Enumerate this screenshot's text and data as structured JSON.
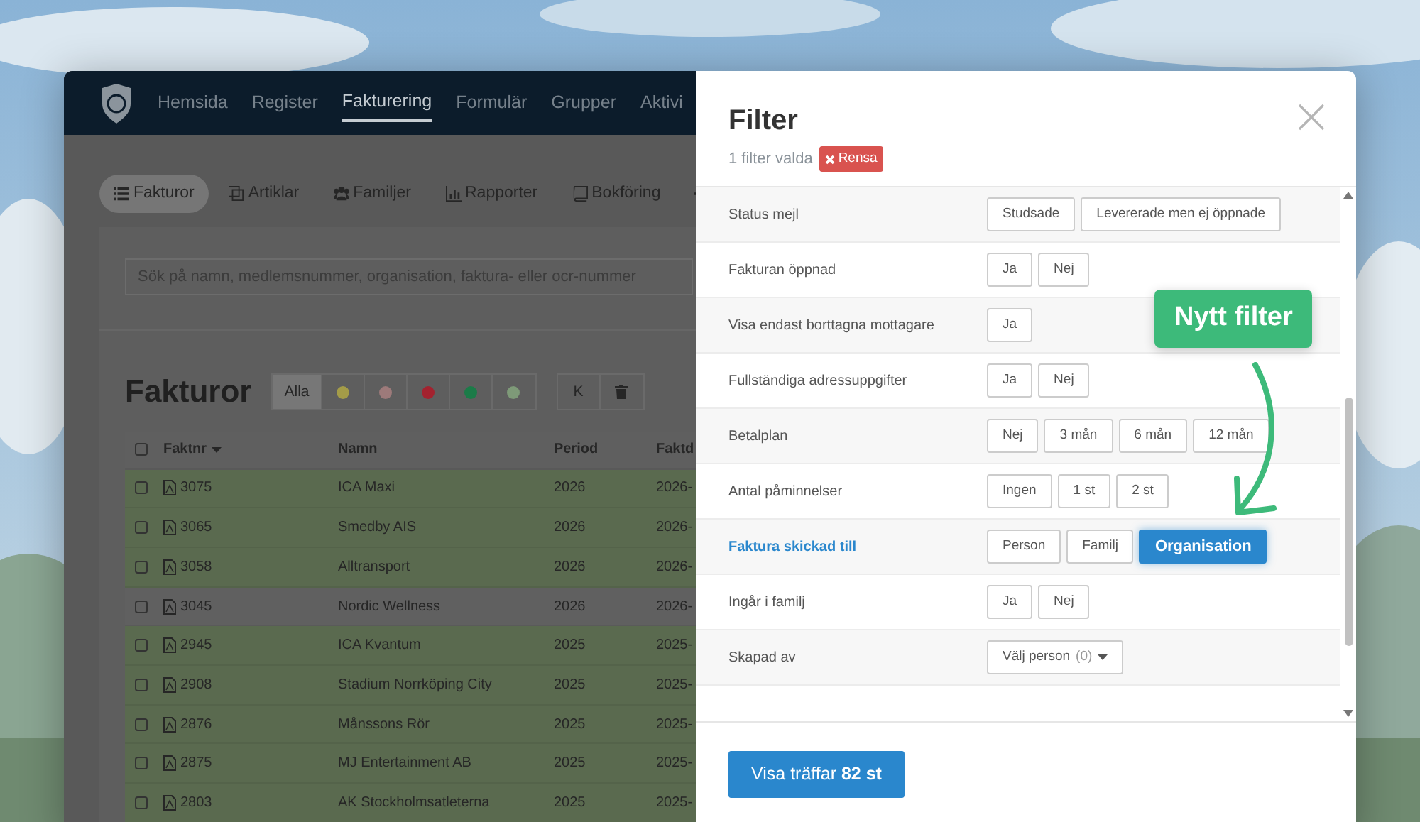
{
  "app": {
    "nav": [
      {
        "label": "Hemsida",
        "selected": false
      },
      {
        "label": "Register",
        "selected": false
      },
      {
        "label": "Fakturering",
        "selected": true
      },
      {
        "label": "Formulär",
        "selected": false
      },
      {
        "label": "Grupper",
        "selected": false
      },
      {
        "label": "Aktivi",
        "selected": false
      }
    ],
    "subnav": [
      {
        "label": "Fakturor",
        "selected": true
      },
      {
        "label": "Artiklar",
        "selected": false
      },
      {
        "label": "Familjer",
        "selected": false
      },
      {
        "label": "Rapporter",
        "selected": false
      },
      {
        "label": "Bokföring",
        "selected": false
      },
      {
        "selected": false
      }
    ],
    "search": {
      "placeholder": "Sök på namn, medlemsnummer, organisation, faktura- eller ocr-nummer"
    },
    "heading": "Fakturor",
    "status_filters": [
      {
        "kind": "text",
        "label": "Alla",
        "selected": true
      },
      {
        "kind": "dot",
        "color": "#a49c48",
        "selected": false
      },
      {
        "kind": "dot",
        "color": "#9d7a7a",
        "selected": false
      },
      {
        "kind": "dot",
        "color": "#a3222f",
        "selected": false
      },
      {
        "kind": "dot",
        "color": "#1b7b48",
        "selected": false
      },
      {
        "kind": "dot",
        "color": "#7e9a78",
        "selected": false
      }
    ],
    "actions": [
      {
        "kind": "text",
        "label": "K"
      },
      {
        "kind": "trash"
      }
    ],
    "table": {
      "all_checked": false,
      "columns": [
        {
          "label": "Faktnr",
          "sorted": true
        },
        {
          "label": "Namn",
          "sorted": false
        },
        {
          "label": "Period",
          "sorted": false
        },
        {
          "label": "Faktd",
          "sorted": false
        }
      ],
      "rows": [
        {
          "nr": "3075",
          "name": "ICA Maxi",
          "period": "2026",
          "date": "2026-",
          "color": "#5a6a4f"
        },
        {
          "nr": "3065",
          "name": "Smedby AIS",
          "period": "2026",
          "date": "2026-",
          "color": "#5a6a4f"
        },
        {
          "nr": "3058",
          "name": "Alltransport",
          "period": "2026",
          "date": "2026-",
          "color": "#5a6a4f"
        },
        {
          "nr": "3045",
          "name": "Nordic Wellness",
          "period": "2026",
          "date": "2026-",
          "color": "#606060"
        },
        {
          "nr": "2945",
          "name": "ICA Kvantum",
          "period": "2025",
          "date": "2025-",
          "color": "#5a6a4f"
        },
        {
          "nr": "2908",
          "name": "Stadium Norrköping City",
          "period": "2025",
          "date": "2025-",
          "color": "#5a6a4f"
        },
        {
          "nr": "2876",
          "name": "Månssons Rör",
          "period": "2025",
          "date": "2025-",
          "color": "#5a6a4f"
        },
        {
          "nr": "2875",
          "name": "MJ Entertainment AB",
          "period": "2025",
          "date": "2025-",
          "color": "#5a6a4f"
        },
        {
          "nr": "2803",
          "name": "AK Stockholmsatleterna",
          "period": "2025",
          "date": "2025-",
          "color": "#5a6a4f"
        }
      ]
    }
  },
  "filter": {
    "title": "Filter",
    "summary": "1 filter valda",
    "clear": "Rensa",
    "rows": [
      {
        "label": "Status mejl",
        "active": false,
        "options": [
          {
            "label": "Studsade",
            "selected": false
          },
          {
            "label": "Levererade men ej öppnade",
            "selected": false
          }
        ]
      },
      {
        "label": "Fakturan öppnad",
        "active": false,
        "options": [
          {
            "label": "Ja",
            "selected": false
          },
          {
            "label": "Nej",
            "selected": false
          }
        ]
      },
      {
        "label": "Visa endast borttagna mottagare",
        "active": false,
        "options": [
          {
            "label": "Ja",
            "selected": false
          }
        ]
      },
      {
        "label": "Fullständiga adressuppgifter",
        "active": false,
        "options": [
          {
            "label": "Ja",
            "selected": false
          },
          {
            "label": "Nej",
            "selected": false
          }
        ]
      },
      {
        "label": "Betalplan",
        "active": false,
        "options": [
          {
            "label": "Nej",
            "selected": false
          },
          {
            "label": "3 mån",
            "selected": false
          },
          {
            "label": "6 mån",
            "selected": false
          },
          {
            "label": "12 mån",
            "selected": false
          }
        ]
      },
      {
        "label": "Antal påminnelser",
        "active": false,
        "options": [
          {
            "label": "Ingen",
            "selected": false
          },
          {
            "label": "1 st",
            "selected": false
          },
          {
            "label": "2 st",
            "selected": false
          }
        ]
      },
      {
        "label": "Faktura skickad till",
        "active": true,
        "options": [
          {
            "label": "Person",
            "selected": false
          },
          {
            "label": "Familj",
            "selected": false
          },
          {
            "label": "Organisation",
            "selected": true
          }
        ]
      },
      {
        "label": "Ingår i familj",
        "active": false,
        "options": [
          {
            "label": "Ja",
            "selected": false
          },
          {
            "label": "Nej",
            "selected": false
          }
        ]
      },
      {
        "label": "Skapad av",
        "active": false,
        "dropdown": {
          "label": "Välj person",
          "count": "(0)"
        }
      }
    ],
    "submit": "Visa träffar **82 st**"
  },
  "annotation": {
    "label": "Nytt filter"
  }
}
